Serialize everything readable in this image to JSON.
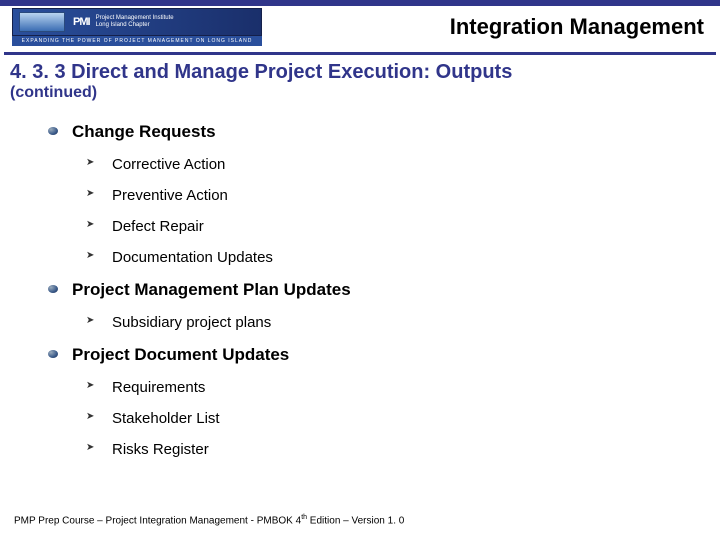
{
  "header": {
    "org1": "Project Management Institute",
    "org2": "Long Island Chapter",
    "tagline": "EXPANDING THE POWER OF PROJECT MANAGEMENT ON LONG ISLAND",
    "page_title": "Integration Management"
  },
  "title": "4. 3. 3 Direct and Manage Project Execution: Outputs",
  "continued": "(continued)",
  "bullets": [
    {
      "label": "Change Requests",
      "children": [
        "Corrective Action",
        "Preventive Action",
        "Defect Repair",
        "Documentation Updates"
      ]
    },
    {
      "label": "Project Management Plan Updates",
      "children": [
        "Subsidiary project plans"
      ]
    },
    {
      "label": "Project Document Updates",
      "children": [
        "Requirements",
        "Stakeholder List",
        "Risks Register"
      ]
    }
  ],
  "footer": {
    "prefix": "PMP Prep Course – Project Integration Management - PMBOK 4",
    "sup": "th",
    "suffix": " Edition – Version 1. 0"
  }
}
